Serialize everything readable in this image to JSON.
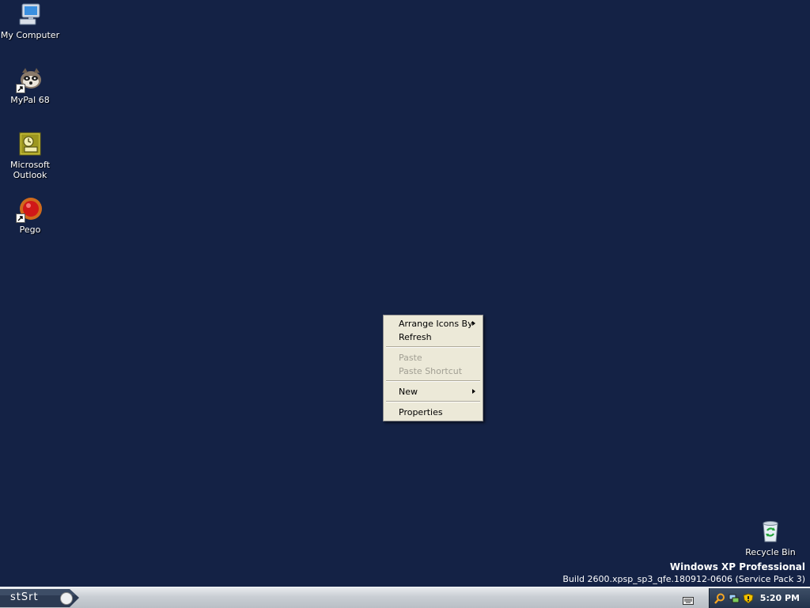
{
  "desktop": {
    "icons": [
      {
        "label": "My Computer",
        "icon": "my-computer-icon"
      },
      {
        "label": "MyPal 68",
        "icon": "mypal-icon"
      },
      {
        "label": "Microsoft Outlook",
        "icon": "outlook-icon"
      },
      {
        "label": "Pego",
        "icon": "pego-icon"
      },
      {
        "label": "Recycle Bin",
        "icon": "recycle-bin-icon"
      }
    ],
    "background_color": "#142245"
  },
  "context_menu": {
    "items": [
      {
        "label": "Arrange Icons By",
        "enabled": true,
        "submenu": true
      },
      {
        "label": "Refresh",
        "enabled": true,
        "submenu": false
      },
      {
        "label": "Paste",
        "enabled": false,
        "submenu": false
      },
      {
        "label": "Paste Shortcut",
        "enabled": false,
        "submenu": false
      },
      {
        "label": "New",
        "enabled": true,
        "submenu": true
      },
      {
        "label": "Properties",
        "enabled": true,
        "submenu": false
      }
    ]
  },
  "watermark": {
    "title": "Windows XP Professional",
    "build": "Build 2600.xpsp_sp3_qfe.180912-0606 (Service Pack 3)"
  },
  "taskbar": {
    "start_label": "stSrt",
    "tray_icons": [
      "search-icon",
      "network-icon",
      "security-shield-icon"
    ],
    "clock": "5:20 PM"
  }
}
